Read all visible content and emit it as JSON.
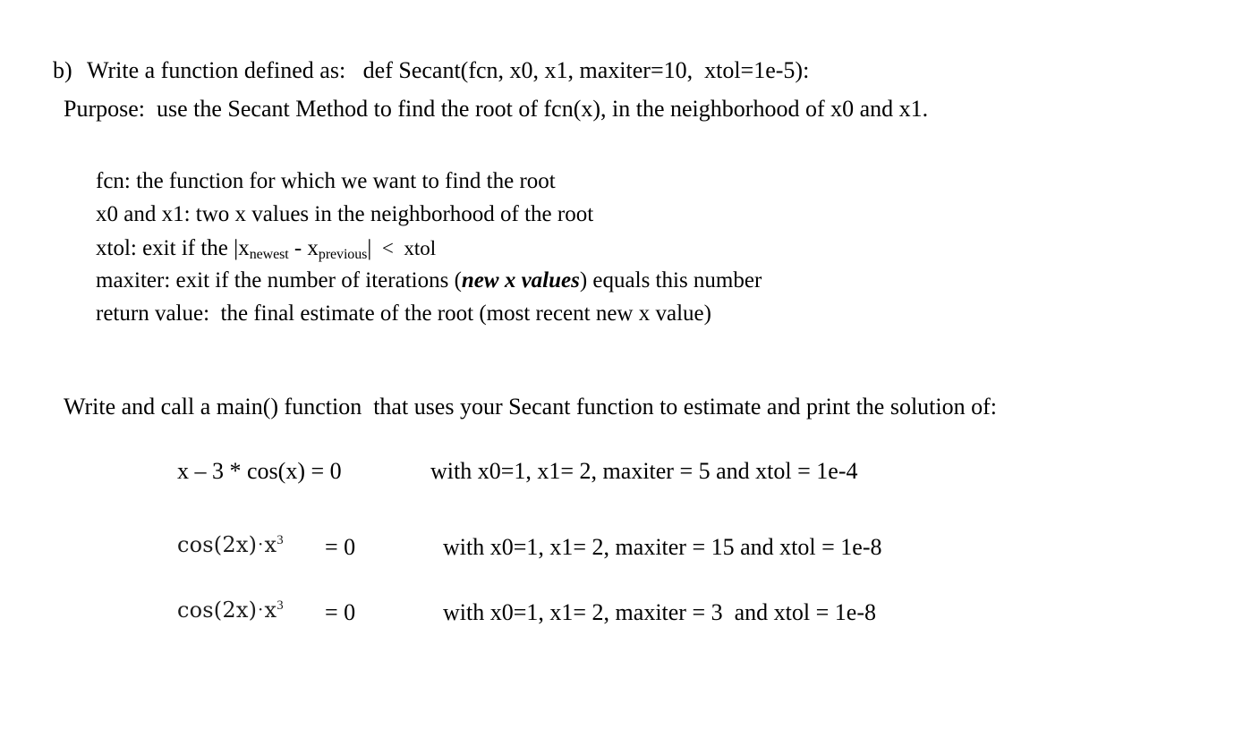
{
  "document": {
    "background_color": "#ffffff",
    "text_color": "#000000"
  },
  "part": {
    "label": "b)",
    "text": "Write a function defined as:   def Secant(fcn, x0, x1, maxiter=10,  xtol=1e-5):"
  },
  "purpose": {
    "text": "Purpose:  use the Secant Method to find the root of fcn(x), in the neighborhood of x0 and x1."
  },
  "parameters": {
    "fcn": "fcn: the function for which we want to find the root",
    "x0_x1": "x0 and x1: two x values in the neighborhood of the root",
    "xtol_prefix": "xtol: exit if the ",
    "xtol_bar_open": "|",
    "xtol_x1": "x",
    "xtol_sub1": "newest",
    "xtol_minus": " - ",
    "xtol_x2": "x",
    "xtol_sub2": "previous",
    "xtol_bar_close": "|",
    "xtol_compare": "  <  xtol",
    "maxiter_prefix": "maxiter: exit if the number of iterations (",
    "maxiter_emph": "new x values",
    "maxiter_suffix": ") equals this number",
    "return_value": "return value:  the final estimate of the root (most recent new x value)"
  },
  "main_instruction": {
    "text": "Write and call a main() function  that uses your Secant function to estimate and print the solution of:"
  },
  "equations": [
    {
      "lhs_plain": "x – 3 * cos(x) = 0",
      "lhs_is_object": false,
      "equals": "",
      "condition": "with x0=1, x1= 2, maxiter = 5 and xtol = 1e-4"
    },
    {
      "lhs_object": {
        "func": "cos(2x)",
        "dot": "·",
        "var": "x",
        "power": "3"
      },
      "lhs_is_object": true,
      "equals": "= 0",
      "condition": "with x0=1, x1= 2, maxiter = 15 and xtol = 1e-8"
    },
    {
      "lhs_object": {
        "func": "cos(2x)",
        "dot": "·",
        "var": "x",
        "power": "3"
      },
      "lhs_is_object": true,
      "equals": "= 0",
      "condition": "with x0=1, x1= 2, maxiter = 3  and xtol = 1e-8"
    }
  ]
}
